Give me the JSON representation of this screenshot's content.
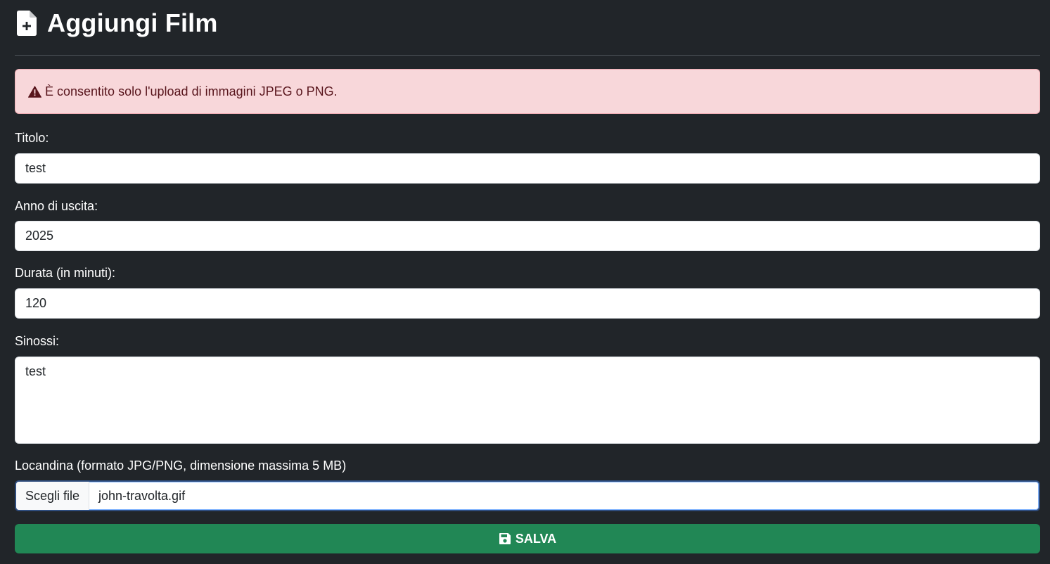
{
  "header": {
    "title": "Aggiungi Film",
    "icon": "file-plus-icon"
  },
  "alert": {
    "icon": "warning-triangle-icon",
    "message": "È consentito solo l'upload di immagini JPEG o PNG."
  },
  "form": {
    "title_label": "Titolo:",
    "title_value": "test",
    "year_label": "Anno di uscita:",
    "year_value": "2025",
    "duration_label": "Durata (in minuti):",
    "duration_value": "120",
    "synopsis_label": "Sinossi:",
    "synopsis_value": "test",
    "poster_label": "Locandina (formato JPG/PNG, dimensione massima 5 MB)",
    "file_button_label": "Scegli file",
    "file_name": "john-travolta.gif",
    "submit_label": "SALVA",
    "submit_icon": "floppy-disk-icon"
  },
  "colors": {
    "background": "#212529",
    "alert_bg": "#f8d7da",
    "alert_text": "#58151c",
    "submit_bg": "#218755"
  }
}
